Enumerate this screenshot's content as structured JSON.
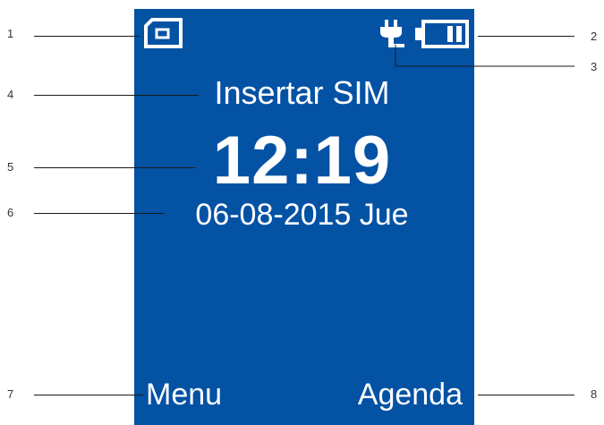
{
  "colors": {
    "screen_background": "#0452a4",
    "screen_text": "#ffffff",
    "leader_line": "#1a1a1a",
    "callout_number": "#333333"
  },
  "screen": {
    "status_text": "Insertar SIM",
    "time": "12:19",
    "date": "06-08-2015 Jue",
    "left_softkey": "Menu",
    "right_softkey": "Agenda"
  },
  "icons": {
    "sim": "sim-card-icon",
    "charging": "charging-plug-icon",
    "battery": "battery-icon"
  },
  "callouts": [
    "1",
    "2",
    "3",
    "4",
    "5",
    "6",
    "7",
    "8"
  ]
}
